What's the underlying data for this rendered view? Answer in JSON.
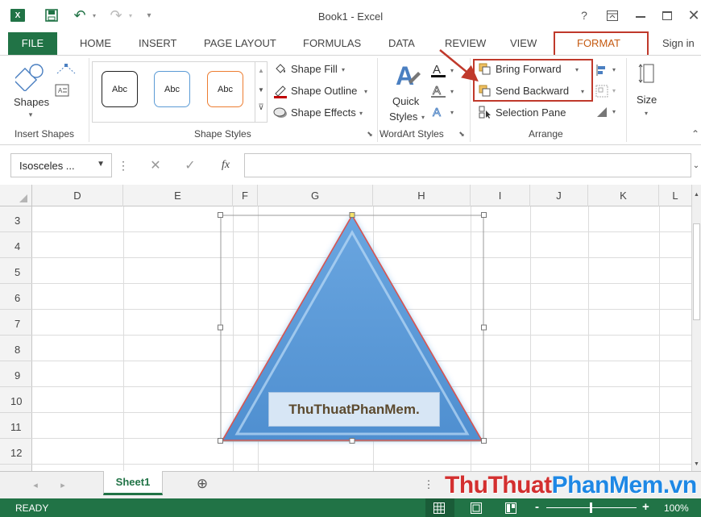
{
  "window": {
    "title": "Book1 - Excel",
    "help": "?",
    "signin": "Sign in"
  },
  "tabs": {
    "file": "FILE",
    "home": "HOME",
    "insert": "INSERT",
    "page_layout": "PAGE LAYOUT",
    "formulas": "FORMULAS",
    "data": "DATA",
    "review": "REVIEW",
    "view": "VIEW",
    "format": "FORMAT"
  },
  "ribbon": {
    "insert_shapes": {
      "shapes_label": "Shapes",
      "group_label": "Insert Shapes"
    },
    "shape_styles": {
      "presets": [
        "Abc",
        "Abc",
        "Abc"
      ],
      "fill": "Shape Fill",
      "outline": "Shape Outline",
      "effects": "Shape Effects",
      "group_label": "Shape Styles"
    },
    "wordart": {
      "quick_styles_line1": "Quick",
      "quick_styles_line2": "Styles",
      "group_label": "WordArt Styles"
    },
    "arrange": {
      "bring_forward": "Bring Forward",
      "send_backward": "Send Backward",
      "selection_pane": "Selection Pane",
      "group_label": "Arrange"
    },
    "size": {
      "label": "Size"
    }
  },
  "formula_bar": {
    "name_box": "Isosceles ...",
    "cancel": "✕",
    "enter": "✓",
    "fx": "fx",
    "value": ""
  },
  "grid": {
    "columns": [
      "D",
      "E",
      "F",
      "G",
      "H",
      "I",
      "J",
      "K",
      "L"
    ],
    "rows": [
      "3",
      "4",
      "5",
      "6",
      "7",
      "8",
      "9",
      "10",
      "11",
      "12"
    ]
  },
  "shape": {
    "type": "isosceles-triangle",
    "text": "ThuThuatPhanMem.",
    "fill": "#5b9bd5",
    "outline": "#d9534f"
  },
  "sheets": {
    "active": "Sheet1",
    "add": "⊕"
  },
  "status": {
    "ready": "READY",
    "zoom": "100%",
    "minus": "-",
    "plus": "+"
  },
  "watermark": {
    "part1": "ThuThuat",
    "part2": "PhanMem",
    "part3": ".vn"
  },
  "colors": {
    "excel_green": "#217346",
    "highlight_red": "#c0392b",
    "watermark_red": "#d32f2f",
    "watermark_blue": "#1e88e5"
  }
}
